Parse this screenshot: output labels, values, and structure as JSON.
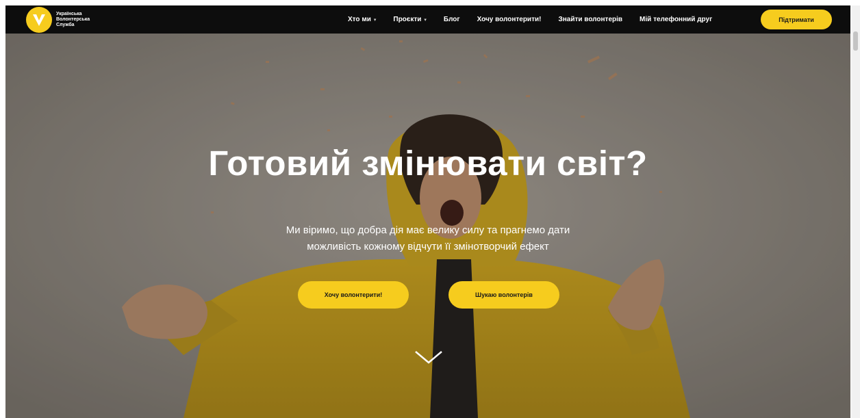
{
  "brand": {
    "name_line1": "Українська",
    "name_line2": "Волонтерська",
    "name_line3": "Служба",
    "accent_color": "#f6cc1e",
    "logo_icon": "v-logo-icon"
  },
  "nav": {
    "items": [
      {
        "label": "Хто ми",
        "has_dropdown": true
      },
      {
        "label": "Проєкти",
        "has_dropdown": true
      },
      {
        "label": "Блог",
        "has_dropdown": false
      },
      {
        "label": "Хочу волонтерити!",
        "has_dropdown": false
      },
      {
        "label": "Знайти волонтерів",
        "has_dropdown": false
      },
      {
        "label": "Мій телефонний друг",
        "has_dropdown": false
      }
    ],
    "cta_label": "Підтримати",
    "caret_glyph": "▾"
  },
  "hero": {
    "title": "Готовий змінювати світ?",
    "subtitle_line1": "Ми віримо, що добра дія має велику силу та прагнемо дати",
    "subtitle_line2": "можливість кожному відчути її змінотворчий ефект",
    "primary_button": "Хочу волонтерити!",
    "secondary_button": "Шукаю волонтерів",
    "scroll_icon": "chevron-down-icon"
  }
}
